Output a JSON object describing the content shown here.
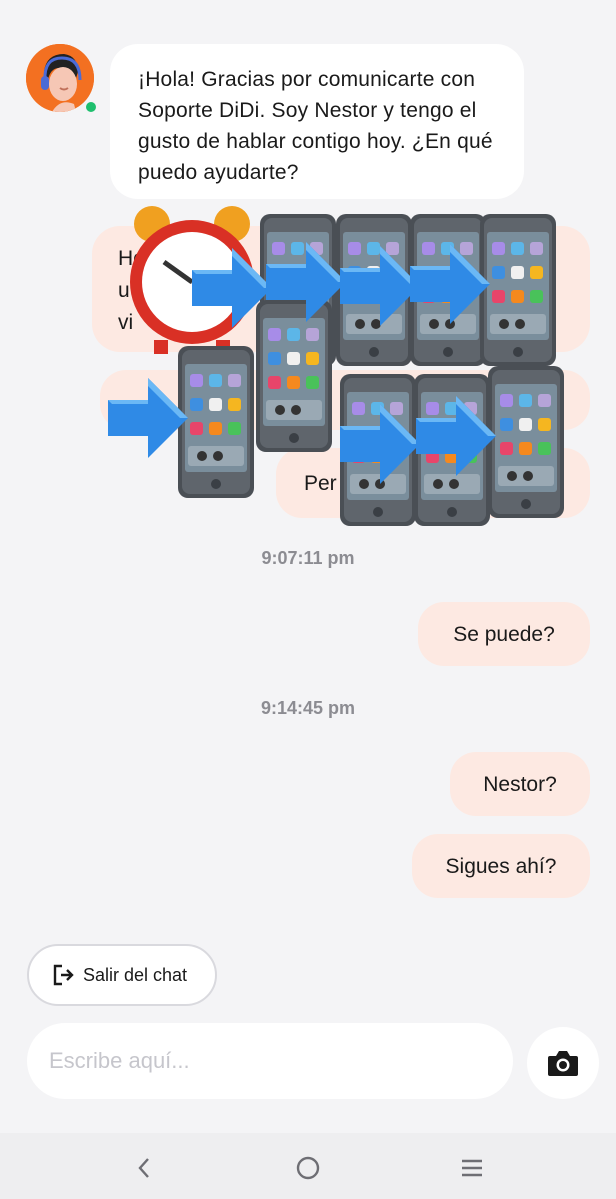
{
  "agent": {
    "message": "¡Hola! Gracias por comunicarte con Soporte DiDi. Soy Nestor y tengo el gusto de hablar contigo hoy. ¿En qué puedo ayudarte?",
    "avatar_icon": "agent-avatar-icon",
    "status": "online"
  },
  "obscured_messages": {
    "first_fragment": "Ho",
    "second_fragment": "u",
    "third_fragment": "vi",
    "fourth_fragment": "Per"
  },
  "sticker": {
    "icons": [
      "alarm-clock-icon",
      "arrow-right-icon",
      "mobile-phone-icon"
    ]
  },
  "timestamps": [
    "9:07:11 pm",
    "9:14:45 pm"
  ],
  "user_messages": [
    "Se puede?",
    "Nestor?",
    "Sigues ahí?"
  ],
  "actions": {
    "exit_label": "Salir del chat"
  },
  "composer": {
    "placeholder": "Escribe aquí..."
  },
  "colors": {
    "user_bubble": "#fde9e2",
    "agent_bubble": "#ffffff",
    "brand_orange": "#f37021",
    "online": "#1fbf6e"
  }
}
